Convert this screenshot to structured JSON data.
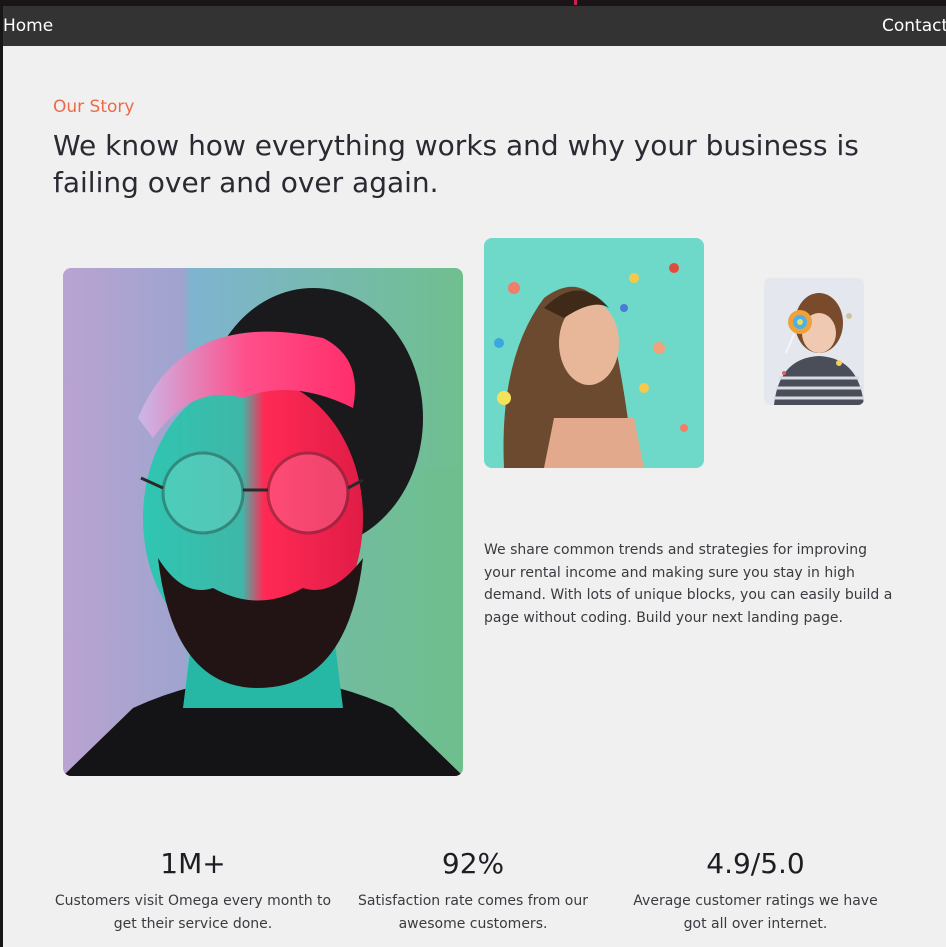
{
  "nav": {
    "home_label": "Home",
    "contact_label": "Contact"
  },
  "story": {
    "eyebrow": "Our Story",
    "headline": "We know how everything works and why your business is failing over and over again.",
    "description": "We share common trends and strategies for improving your rental income and making sure you stay in high demand. With lots of unique blocks, you can easily build a page without coding. Build your next landing page."
  },
  "stats": [
    {
      "value": "1M+",
      "caption": "Customers visit Omega every month to get their service done."
    },
    {
      "value": "92%",
      "caption": "Satisfaction rate comes from our awesome customers."
    },
    {
      "value": "4.9/5.0",
      "caption": "Average customer ratings we have got all over internet."
    }
  ],
  "colors": {
    "accent": "#ec6a4a",
    "navbar": "#333333",
    "page_background": "#f0f0f0",
    "headline": "#2a2a33"
  }
}
